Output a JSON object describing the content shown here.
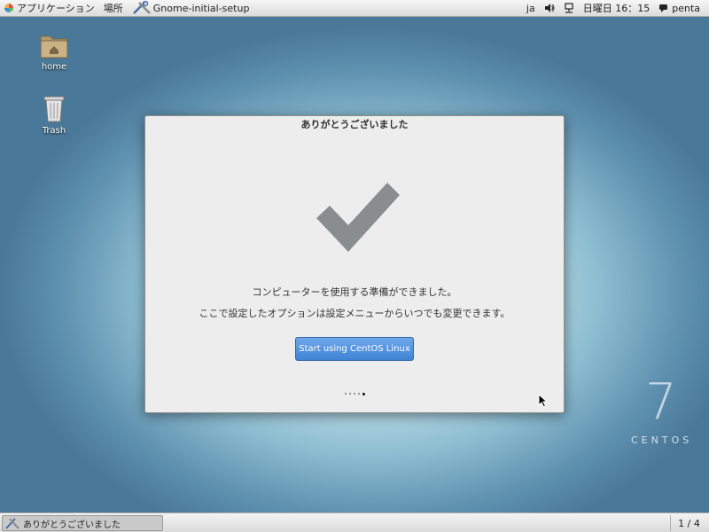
{
  "top_panel": {
    "applications": "アプリケーション",
    "places": "場所",
    "active_window": "Gnome-initial-setup",
    "language": "ja",
    "datetime": "日曜日 16：15",
    "user": "penta"
  },
  "desktop": {
    "icons": [
      {
        "label": "home"
      },
      {
        "label": "Trash"
      }
    ],
    "wallpaper_mark": {
      "number": "7",
      "word": "CENTOS"
    }
  },
  "dialog": {
    "title": "ありがとうございました",
    "message_1": "コンピューターを使用する準備ができました。",
    "message_2": "ここで設定したオプションは設定メニューからいつでも変更できます。",
    "start_button": "Start using CentOS Linux",
    "pages": {
      "count": 5,
      "current": 5
    }
  },
  "bottom_panel": {
    "task_title": "ありがとうございました",
    "workspace": "1 / 4"
  },
  "colors": {
    "accent_button": "#4a8fe0",
    "check_mark": "#8a8d8e",
    "dialog_bg": "#ededed"
  }
}
